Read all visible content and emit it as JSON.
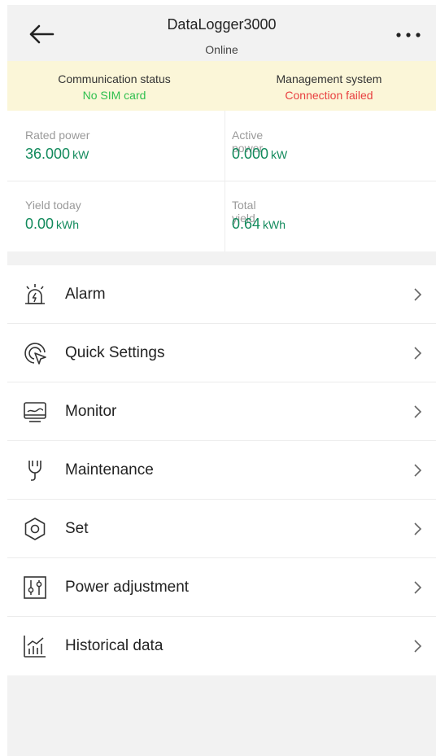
{
  "header": {
    "title": "DataLogger3000",
    "subtitle": "Online",
    "back_icon": "arrow-left-icon",
    "more_icon": "more-horizontal-icon"
  },
  "status": {
    "communication": {
      "label": "Communication status",
      "value": "No SIM card",
      "color": "#2fbf4e"
    },
    "management": {
      "label": "Management system",
      "value": "Connection failed",
      "color": "#e84040"
    }
  },
  "metrics": {
    "rated_power": {
      "label": "Rated power",
      "value": "36.000",
      "unit": "kW"
    },
    "active_power": {
      "label": "Active power",
      "value": "0.000",
      "unit": "kW"
    },
    "yield_today": {
      "label": "Yield today",
      "value": "0.00",
      "unit": "kWh"
    },
    "total_yield": {
      "label": "Total yield",
      "value": "0.64",
      "unit": "kWh"
    }
  },
  "menu": {
    "items": [
      {
        "label": "Alarm",
        "icon": "alarm-icon"
      },
      {
        "label": "Quick Settings",
        "icon": "quick-settings-icon"
      },
      {
        "label": "Monitor",
        "icon": "monitor-icon"
      },
      {
        "label": "Maintenance",
        "icon": "maintenance-icon"
      },
      {
        "label": "Set",
        "icon": "settings-hex-icon"
      },
      {
        "label": "Power adjustment",
        "icon": "power-adjustment-icon"
      },
      {
        "label": "Historical data",
        "icon": "historical-data-icon"
      }
    ]
  },
  "colors": {
    "accent_value": "#128a5c",
    "status_bg": "#fbf6d8",
    "page_bg": "#f2f2f2"
  }
}
